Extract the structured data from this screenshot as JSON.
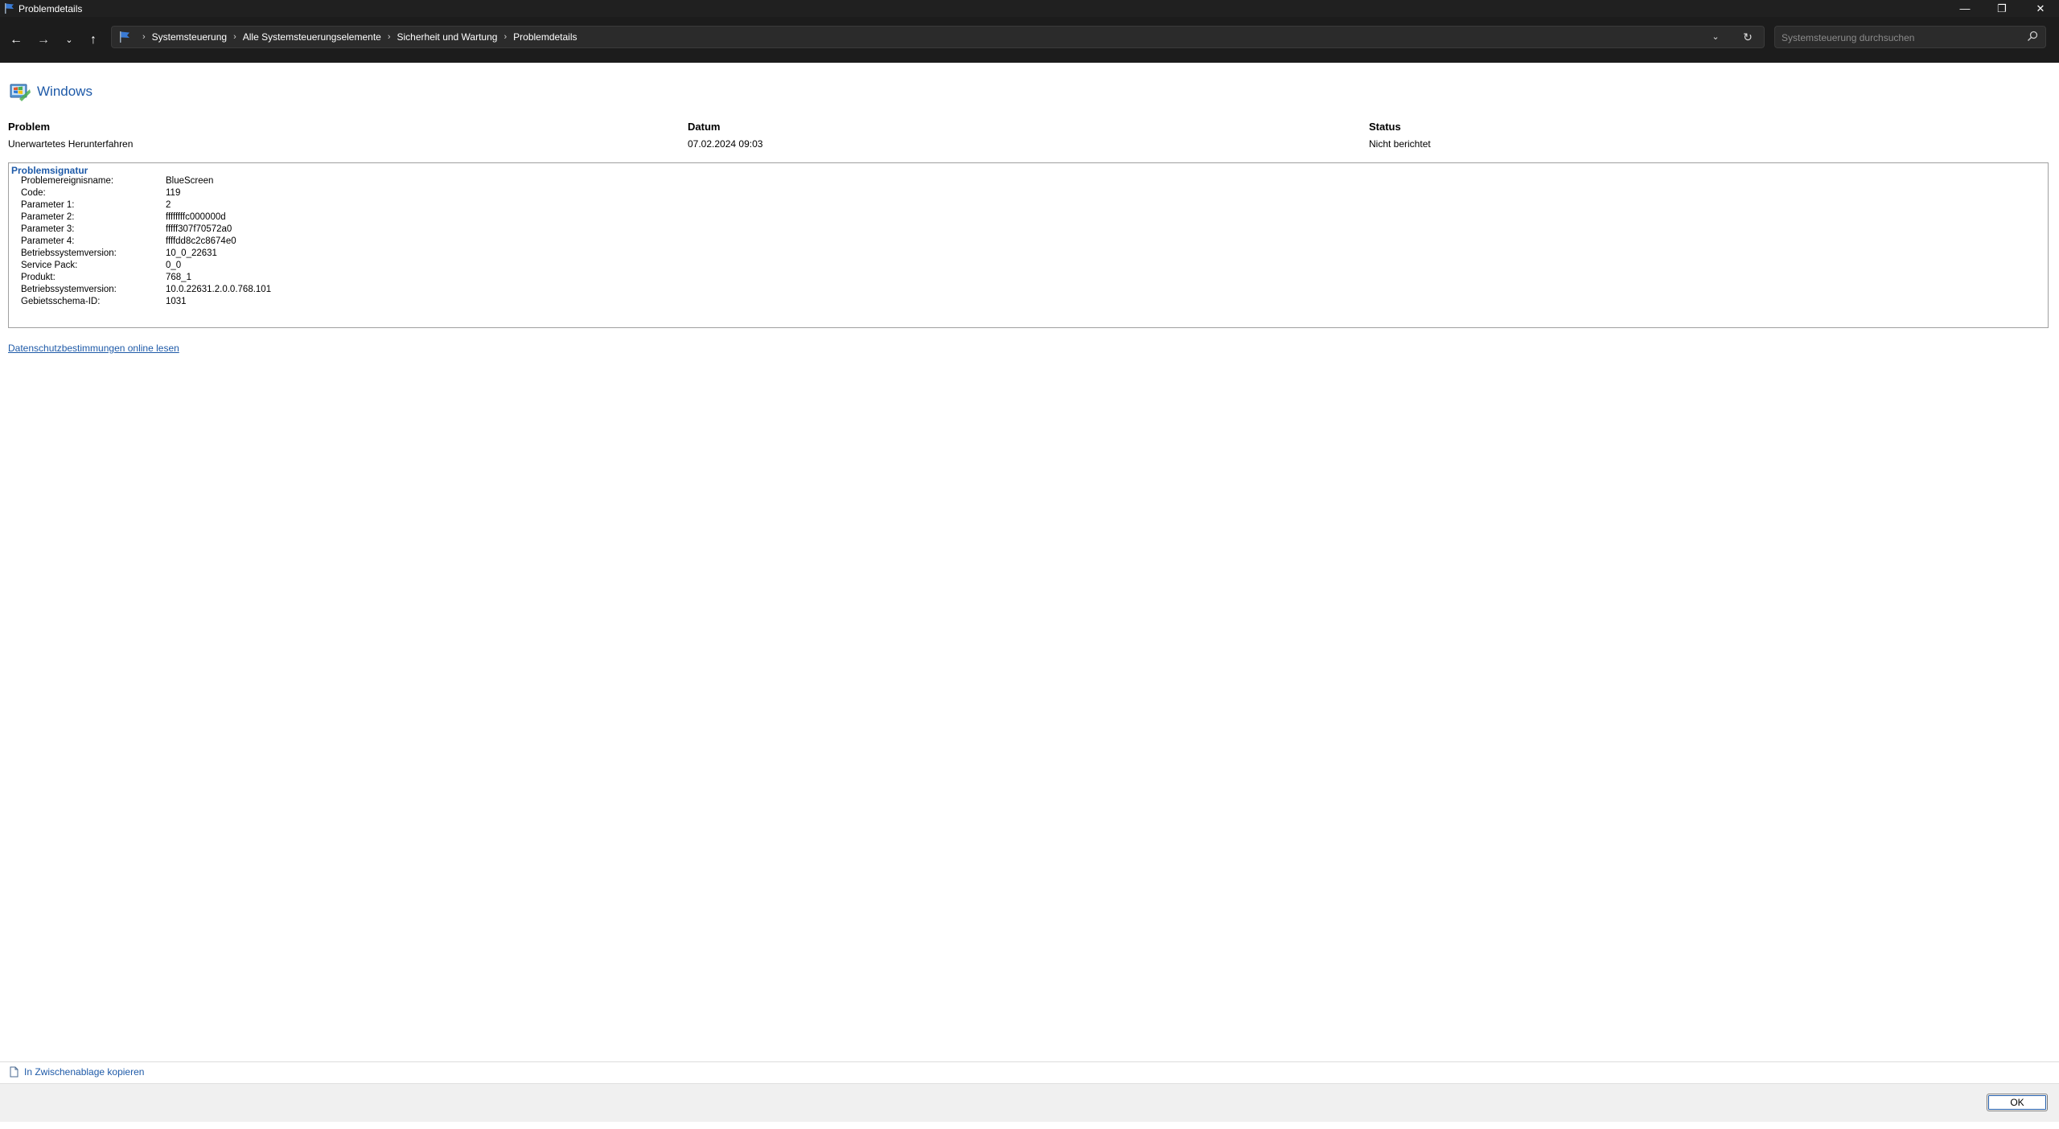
{
  "window": {
    "title": "Problemdetails",
    "minimize": "—",
    "maximize": "❐",
    "close": "✕"
  },
  "nav": {
    "back": "←",
    "forward": "→",
    "recent": "⌄",
    "up": "↑",
    "breadcrumb": [
      "Systemsteuerung",
      "Alle Systemsteuerungselemente",
      "Sicherheit und Wartung",
      "Problemdetails"
    ],
    "separator": "›",
    "dropdown": "⌄",
    "refresh": "↻"
  },
  "search": {
    "placeholder": "Systemsteuerung durchsuchen"
  },
  "brand": {
    "text": "Windows"
  },
  "columns": {
    "problem_header": "Problem",
    "date_header": "Datum",
    "status_header": "Status",
    "problem_value": "Unerwartetes Herunterfahren",
    "date_value": "07.02.2024 09:03",
    "status_value": "Nicht berichtet"
  },
  "signature": {
    "title": "Problemsignatur",
    "rows": [
      {
        "key": "Problemereignisname:",
        "value": "BlueScreen"
      },
      {
        "key": "Code:",
        "value": "119"
      },
      {
        "key": "Parameter 1:",
        "value": "2"
      },
      {
        "key": "Parameter 2:",
        "value": "ffffffffc000000d"
      },
      {
        "key": "Parameter 3:",
        "value": "fffff307f70572a0"
      },
      {
        "key": "Parameter 4:",
        "value": "ffffdd8c2c8674e0"
      },
      {
        "key": "Betriebssystemversion:",
        "value": "10_0_22631"
      },
      {
        "key": "Service Pack:",
        "value": "0_0"
      },
      {
        "key": "Produkt:",
        "value": "768_1"
      },
      {
        "key": "Betriebssystemversion:",
        "value": "10.0.22631.2.0.0.768.101"
      },
      {
        "key": "Gebietsschema-ID:",
        "value": "1031"
      }
    ]
  },
  "links": {
    "privacy": "Datenschutzbestimmungen online lesen",
    "copy": "In Zwischenablage kopieren"
  },
  "footer": {
    "ok": "OK"
  },
  "colors": {
    "accent": "#1e5aa8",
    "titlebar": "#202020",
    "navbar": "#1c1c1c"
  }
}
